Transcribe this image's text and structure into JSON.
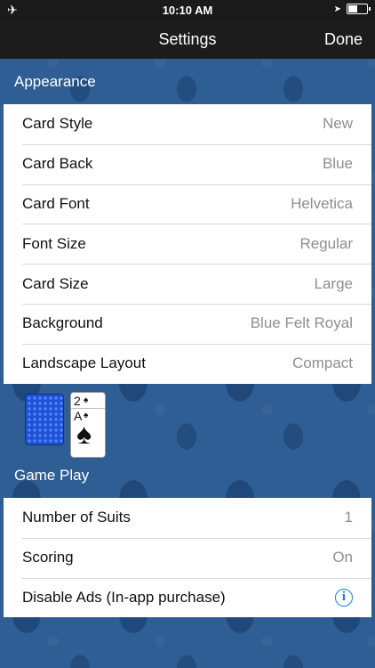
{
  "status_bar": {
    "time": "10:10 AM",
    "left_icon": "airplane-icon",
    "right_icons": [
      "location-arrow-icon",
      "battery-icon"
    ]
  },
  "nav": {
    "title": "Settings",
    "done_label": "Done"
  },
  "appearance": {
    "header": "Appearance",
    "rows": [
      {
        "label": "Card Style",
        "value": "New"
      },
      {
        "label": "Card Back",
        "value": "Blue"
      },
      {
        "label": "Card Font",
        "value": "Helvetica"
      },
      {
        "label": "Font Size",
        "value": "Regular"
      },
      {
        "label": "Card Size",
        "value": "Large"
      },
      {
        "label": "Background",
        "value": "Blue Felt Royal"
      },
      {
        "label": "Landscape Layout",
        "value": "Compact"
      }
    ]
  },
  "preview": {
    "card_top_rank": "2",
    "card_top_suit": "♠",
    "card_rank": "A",
    "card_suit": "♠"
  },
  "game_play": {
    "header": "Game Play",
    "rows": [
      {
        "label": "Number of Suits",
        "value": "1"
      },
      {
        "label": "Scoring",
        "value": "On"
      },
      {
        "label": "Disable Ads (In-app purchase)",
        "info_icon": "i"
      }
    ]
  },
  "colors": {
    "background": "#2e5e94",
    "nav_bar": "#1c1c1c",
    "accent": "#1e7fd8",
    "secondary_text": "#8e8e93"
  }
}
